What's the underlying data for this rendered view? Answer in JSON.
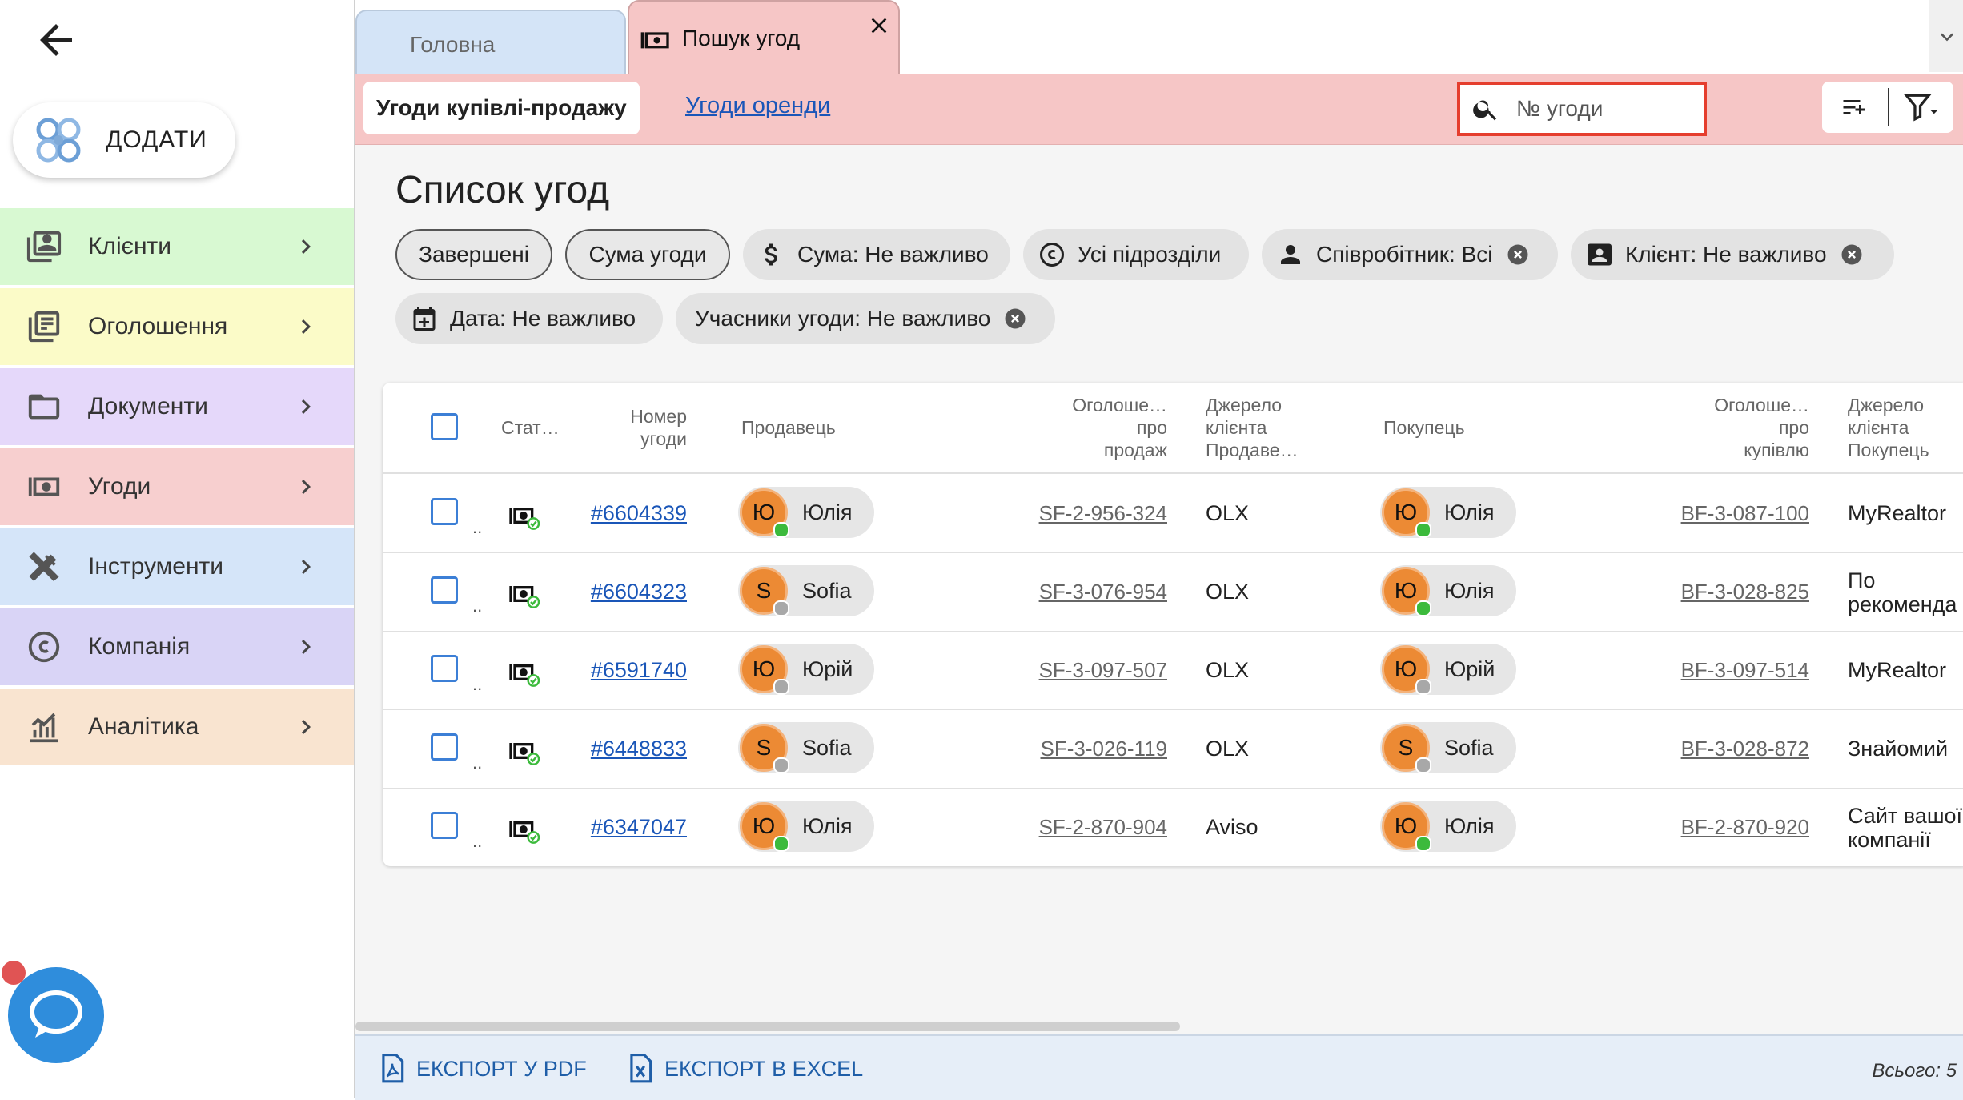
{
  "sidebar": {
    "add_label": "ДОДАТИ",
    "items": [
      {
        "label": "Клієнти",
        "bg": "#d8f9d2",
        "icon": "contacts-icon"
      },
      {
        "label": "Оголошення",
        "bg": "#fbfbc8",
        "icon": "listings-icon"
      },
      {
        "label": "Документи",
        "bg": "#e5d8fa",
        "icon": "folder-icon"
      },
      {
        "label": "Угоди",
        "bg": "#f7cfcf",
        "icon": "money-icon"
      },
      {
        "label": "Інструменти",
        "bg": "#d5e5f9",
        "icon": "tools-icon"
      },
      {
        "label": "Компанія",
        "bg": "#d9d4f6",
        "icon": "copyright-icon"
      },
      {
        "label": "Аналітика",
        "bg": "#f9e4d0",
        "icon": "analytics-icon"
      }
    ]
  },
  "tabs": {
    "home": "Головна",
    "deals": "Пошук угод"
  },
  "subtabs": {
    "active": "Угоди купівлі-продажу",
    "rent": "Угоди оренди"
  },
  "search": {
    "placeholder": "№ угоди"
  },
  "page_title": "Список угод",
  "chips": [
    {
      "label": "Завершені",
      "variant": "outline"
    },
    {
      "label": "Сума угоди",
      "variant": "outline"
    },
    {
      "label": "Сума: Не важливо",
      "icon": "dollar-icon"
    },
    {
      "label": "Усі підрозділи",
      "icon": "copyright-icon"
    },
    {
      "label": "Співробітник: Всі",
      "icon": "person-icon",
      "removable": true
    },
    {
      "label": "Клієнт: Не важливо",
      "icon": "contact-card-icon",
      "removable": true
    },
    {
      "label": "Дата: Не важливо",
      "icon": "calendar-add-icon"
    },
    {
      "label": "Учасники угоди: Не важливо",
      "removable": true
    }
  ],
  "table": {
    "headers": {
      "status": "Стат…",
      "number_1": "Номер",
      "number_2": "угоди",
      "seller": "Продавець",
      "sale_ad_1": "Оголоше…",
      "sale_ad_2": "про",
      "sale_ad_3": "продаж",
      "seller_src_1": "Джерело",
      "seller_src_2": "клієнта",
      "seller_src_3": "Продаве…",
      "buyer": "Покупець",
      "buy_ad_1": "Оголоше…",
      "buy_ad_2": "про",
      "buy_ad_3": "купівлю",
      "buyer_src_1": "Джерело",
      "buyer_src_2": "клієнта",
      "buyer_src_3": "Покупець"
    },
    "rows": [
      {
        "status_dots": "..",
        "number": "#6604339",
        "seller": {
          "initial": "Ю",
          "name": "Юлія",
          "online": true
        },
        "sale_ad": "SF-2-956-324",
        "seller_source": "OLX",
        "buyer": {
          "initial": "Ю",
          "name": "Юлія",
          "online": true
        },
        "buy_ad": "BF-3-087-100",
        "buyer_source_1": "MyRealtor",
        "buyer_source_2": ""
      },
      {
        "status_dots": "..",
        "number": "#6604323",
        "seller": {
          "initial": "S",
          "name": "Sofia",
          "online": false
        },
        "sale_ad": "SF-3-076-954",
        "seller_source": "OLX",
        "buyer": {
          "initial": "Ю",
          "name": "Юлія",
          "online": true
        },
        "buy_ad": "BF-3-028-825",
        "buyer_source_1": "По",
        "buyer_source_2": "рекоменда"
      },
      {
        "status_dots": "..",
        "number": "#6591740",
        "seller": {
          "initial": "Ю",
          "name": "Юрій",
          "online": false
        },
        "sale_ad": "SF-3-097-507",
        "seller_source": "OLX",
        "buyer": {
          "initial": "Ю",
          "name": "Юрій",
          "online": false
        },
        "buy_ad": "BF-3-097-514",
        "buyer_source_1": "MyRealtor",
        "buyer_source_2": ""
      },
      {
        "status_dots": "..",
        "number": "#6448833",
        "seller": {
          "initial": "S",
          "name": "Sofia",
          "online": false
        },
        "sale_ad": "SF-3-026-119",
        "seller_source": "OLX",
        "buyer": {
          "initial": "S",
          "name": "Sofia",
          "online": false
        },
        "buy_ad": "BF-3-028-872",
        "buyer_source_1": "Знайомий",
        "buyer_source_2": ""
      },
      {
        "status_dots": "..",
        "number": "#6347047",
        "seller": {
          "initial": "Ю",
          "name": "Юлія",
          "online": true
        },
        "sale_ad": "SF-2-870-904",
        "seller_source": "Aviso",
        "buyer": {
          "initial": "Ю",
          "name": "Юлія",
          "online": true
        },
        "buy_ad": "BF-2-870-920",
        "buyer_source_1": "Сайт вашої",
        "buyer_source_2": "компанії"
      }
    ]
  },
  "footer": {
    "export_pdf": "ЕКСПОРТ У PDF",
    "export_excel": "ЕКСПОРТ В EXCEL",
    "total": "Всього: 5"
  },
  "colors": {
    "accent_blue": "#1a56b8",
    "deals_tab": "#f6c6c6",
    "avatar_orange": "#ec8a34",
    "online_green": "#3cba3c",
    "offline_gray": "#a8a8a8",
    "search_border": "#e53e2e"
  }
}
